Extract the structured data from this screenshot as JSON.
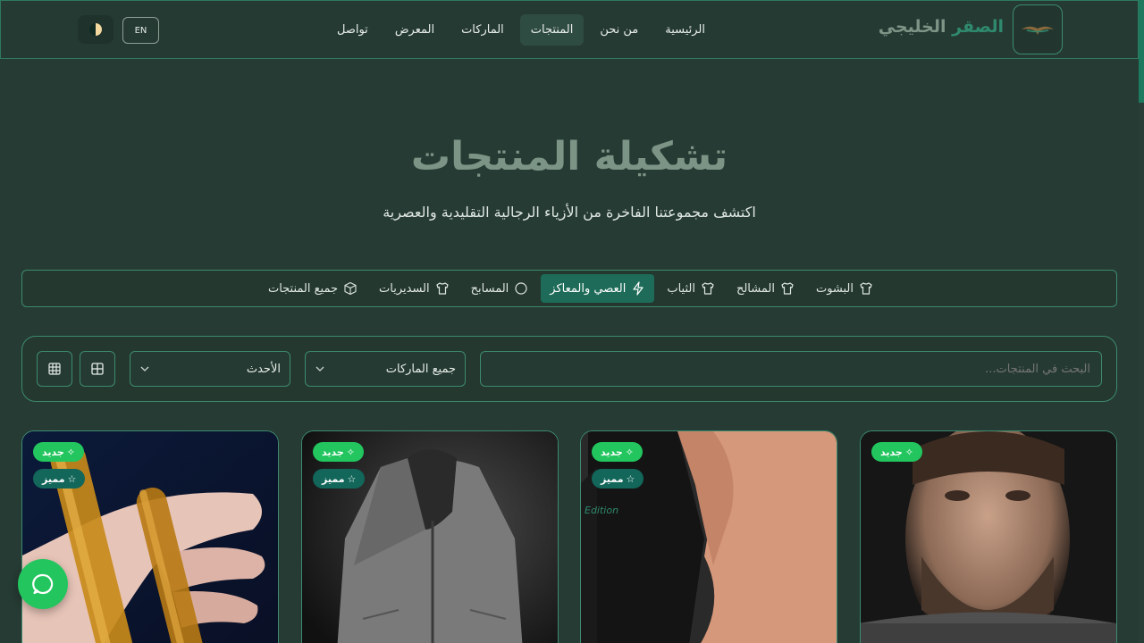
{
  "header": {
    "brand_part1": "الصقر",
    "brand_part2": "الخليجي",
    "nav": [
      "الرئيسية",
      "من نحن",
      "المنتجات",
      "الماركات",
      "المعرض",
      "تواصل"
    ],
    "active_nav_index": 2,
    "lang_button": "EN"
  },
  "hero": {
    "title": "تشكيلة المنتجات",
    "subtitle": "اكتشف مجموعتنا الفاخرة من الأزياء الرجالية التقليدية والعصرية"
  },
  "categories": [
    {
      "label": "البشوت",
      "icon": "shirt-icon"
    },
    {
      "label": "المشالح",
      "icon": "shirt-icon"
    },
    {
      "label": "الثياب",
      "icon": "shirt-icon"
    },
    {
      "label": "العصي والمعاكز",
      "icon": "zap-icon",
      "active": true
    },
    {
      "label": "المسابح",
      "icon": "circle-icon"
    },
    {
      "label": "السديريات",
      "icon": "shirt-icon"
    },
    {
      "label": "جميع المنتجات",
      "icon": "package-icon"
    }
  ],
  "filters": {
    "search_placeholder": "البحث في المنتجات...",
    "brand_select": "جميع الماركات",
    "sort_select": "الأحدث"
  },
  "products": [
    {
      "badges": [
        "جديد"
      ],
      "image": "man-portrait"
    },
    {
      "badges": [
        "جديد",
        "مميز"
      ],
      "image": "leather-vest",
      "overlay_text": "Edition"
    },
    {
      "badges": [
        "جديد",
        "مميز"
      ],
      "image": "gray-vest"
    },
    {
      "badges": [
        "جديد",
        "مميز"
      ],
      "image": "amber-rosary"
    }
  ],
  "colors": {
    "accent": "#1d6b58",
    "badge_new": "#22c55e",
    "badge_featured": "#12665a",
    "background": "#263b34",
    "border": "#3d8b6f"
  }
}
